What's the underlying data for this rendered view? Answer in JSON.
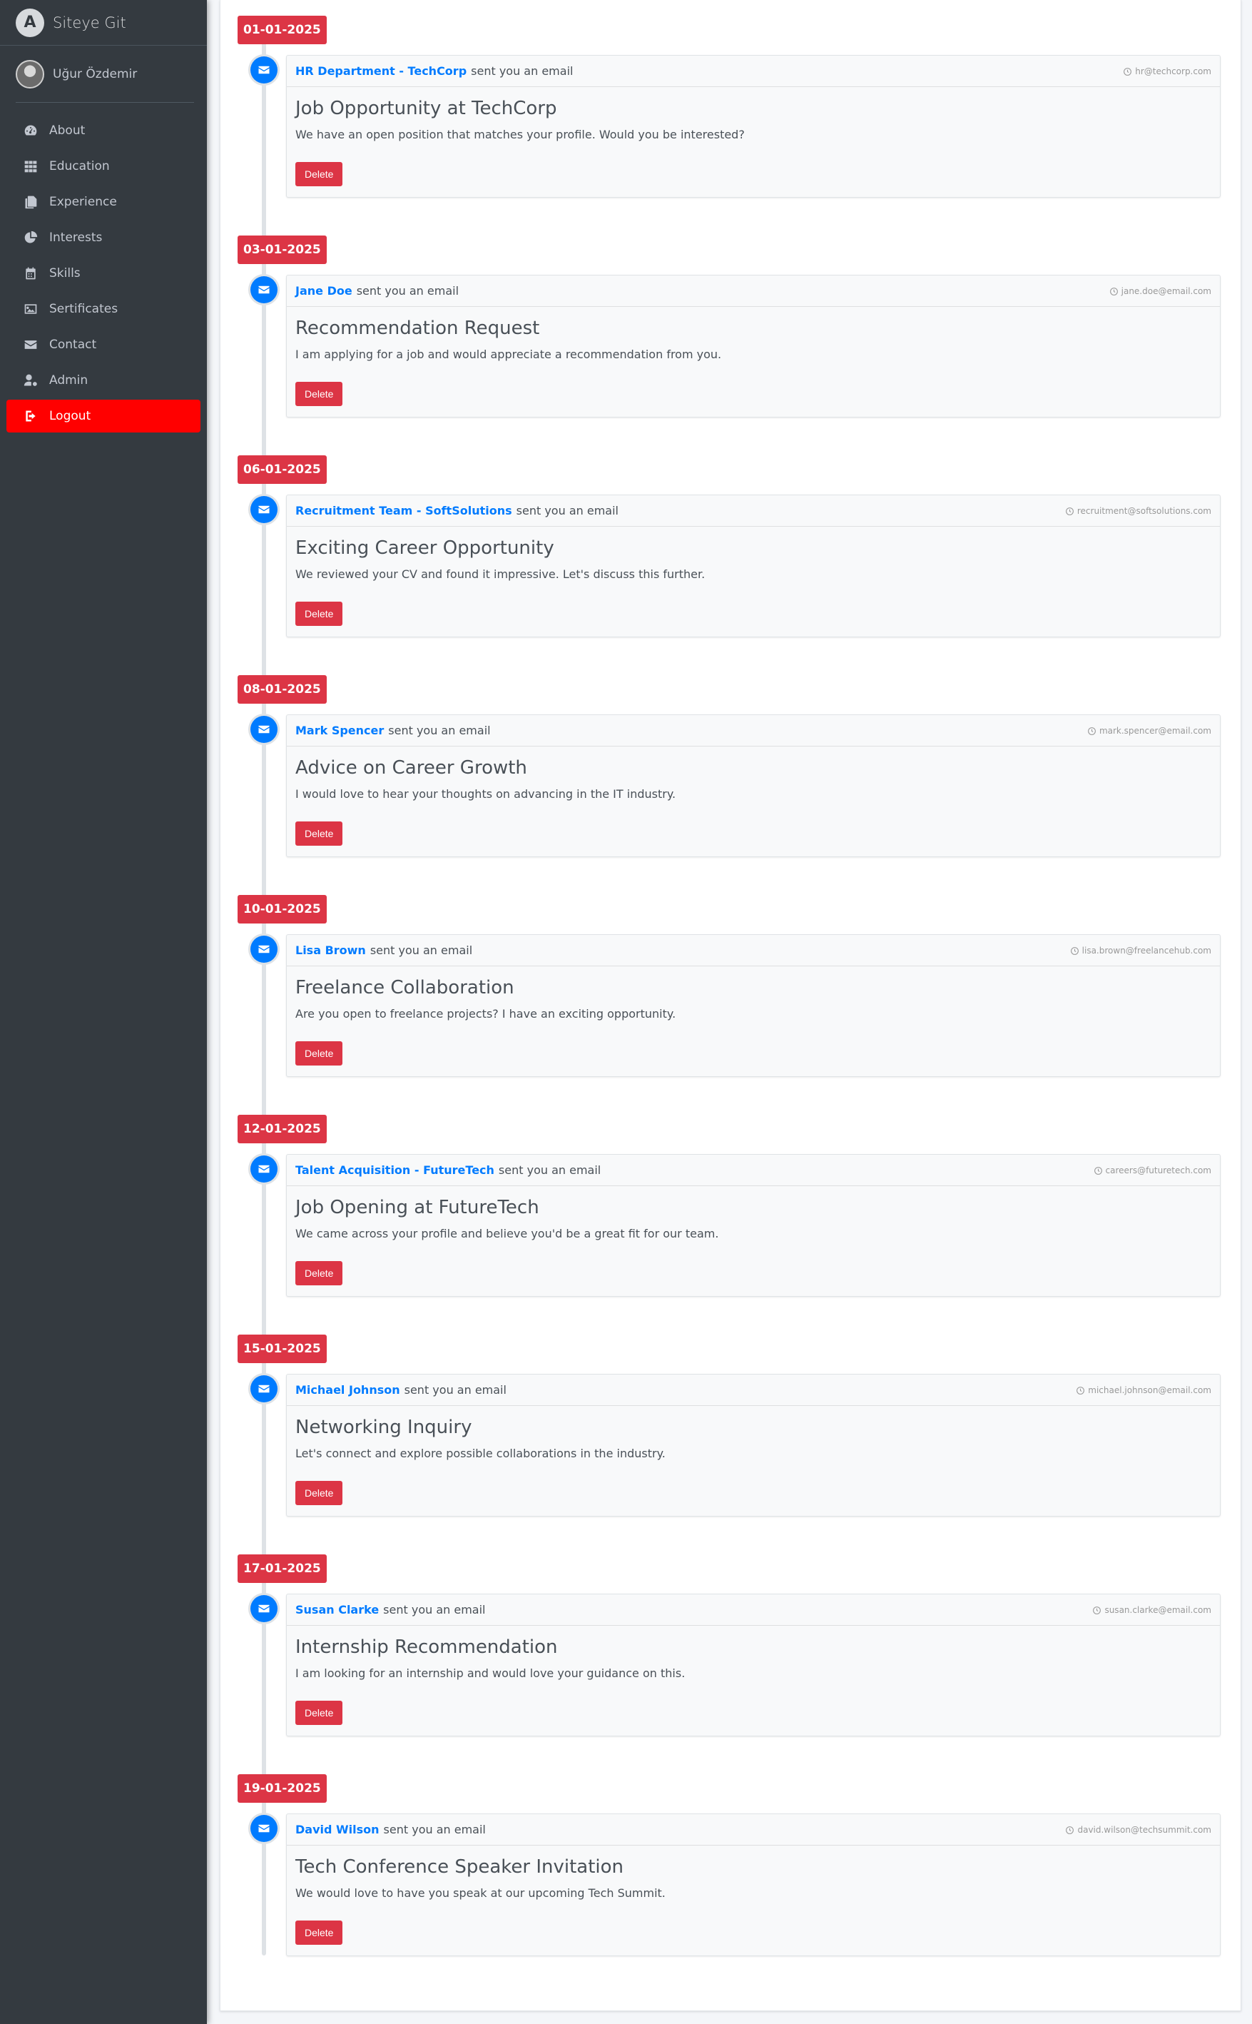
{
  "brand": {
    "name": "Siteye Git",
    "logo_letter": "A"
  },
  "user": {
    "name": "Uğur Özdemir"
  },
  "nav": [
    {
      "label": "About",
      "icon": "tachometer-icon"
    },
    {
      "label": "Education",
      "icon": "grid-icon"
    },
    {
      "label": "Experience",
      "icon": "copy-icon"
    },
    {
      "label": "Interests",
      "icon": "pie-chart-icon"
    },
    {
      "label": "Skills",
      "icon": "calendar-icon"
    },
    {
      "label": "Sertificates",
      "icon": "image-icon"
    },
    {
      "label": "Contact",
      "icon": "envelope-icon"
    },
    {
      "label": "Admin",
      "icon": "user-cog-icon"
    },
    {
      "label": "Logout",
      "icon": "sign-out-icon",
      "active": true
    }
  ],
  "colors": {
    "sidebar": "#343a40",
    "accent_red": "#dc3545",
    "logout_red": "#ff0000",
    "link_blue": "#007bff"
  },
  "timeline": {
    "sent_suffix": "sent you an email",
    "delete_label": "Delete",
    "entries": [
      {
        "date": "01-01-2025",
        "sender": "HR Department - TechCorp",
        "email": "hr@techcorp.com",
        "subject": "Job Opportunity at TechCorp",
        "message": "We have an open position that matches your profile. Would you be interested?"
      },
      {
        "date": "03-01-2025",
        "sender": "Jane Doe",
        "email": "jane.doe@email.com",
        "subject": "Recommendation Request",
        "message": "I am applying for a job and would appreciate a recommendation from you."
      },
      {
        "date": "06-01-2025",
        "sender": "Recruitment Team - SoftSolutions",
        "email": "recruitment@softsolutions.com",
        "subject": "Exciting Career Opportunity",
        "message": "We reviewed your CV and found it impressive. Let's discuss this further."
      },
      {
        "date": "08-01-2025",
        "sender": "Mark Spencer",
        "email": "mark.spencer@email.com",
        "subject": "Advice on Career Growth",
        "message": "I would love to hear your thoughts on advancing in the IT industry."
      },
      {
        "date": "10-01-2025",
        "sender": "Lisa Brown",
        "email": "lisa.brown@freelancehub.com",
        "subject": "Freelance Collaboration",
        "message": "Are you open to freelance projects? I have an exciting opportunity."
      },
      {
        "date": "12-01-2025",
        "sender": "Talent Acquisition - FutureTech",
        "email": "careers@futuretech.com",
        "subject": "Job Opening at FutureTech",
        "message": "We came across your profile and believe you'd be a great fit for our team."
      },
      {
        "date": "15-01-2025",
        "sender": "Michael Johnson",
        "email": "michael.johnson@email.com",
        "subject": "Networking Inquiry",
        "message": "Let's connect and explore possible collaborations in the industry."
      },
      {
        "date": "17-01-2025",
        "sender": "Susan Clarke",
        "email": "susan.clarke@email.com",
        "subject": "Internship Recommendation",
        "message": "I am looking for an internship and would love your guidance on this."
      },
      {
        "date": "19-01-2025",
        "sender": "David Wilson",
        "email": "david.wilson@techsummit.com",
        "subject": "Tech Conference Speaker Invitation",
        "message": "We would love to have you speak at our upcoming Tech Summit."
      }
    ]
  }
}
